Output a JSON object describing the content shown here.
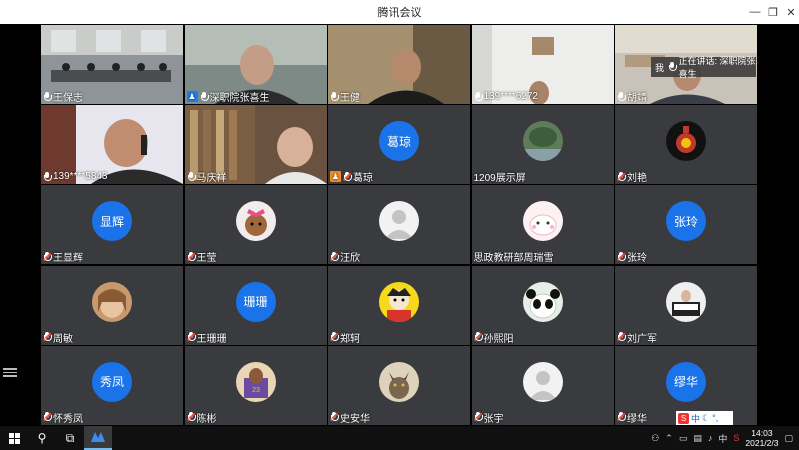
{
  "window": {
    "title": "腾讯会议"
  },
  "speaking_tip": {
    "me": "我",
    "label": "正在讲话: 深职院张喜生"
  },
  "participants": [
    {
      "name": "王保志"
    },
    {
      "name": "深职院张喜生"
    },
    {
      "name": "王健"
    },
    {
      "name": "139****6272"
    },
    {
      "name": "胡靖"
    },
    {
      "name": "139****5843"
    },
    {
      "name": "马庆祥"
    },
    {
      "name": "葛琼",
      "avatar_text": "葛琼"
    },
    {
      "name": "1209展示屏"
    },
    {
      "name": "刘艳"
    },
    {
      "name": "王显辉",
      "avatar_text": "显辉"
    },
    {
      "name": "王莹"
    },
    {
      "name": "汪欣"
    },
    {
      "name": "思政教研部周瑞雪"
    },
    {
      "name": "张玲",
      "avatar_text": "张玲"
    },
    {
      "name": "周敏"
    },
    {
      "name": "王珊珊",
      "avatar_text": "珊珊"
    },
    {
      "name": "郑轲"
    },
    {
      "name": "孙熙阳"
    },
    {
      "name": "刘广军"
    },
    {
      "name": "怀秀凤",
      "avatar_text": "秀凤"
    },
    {
      "name": "陈彬"
    },
    {
      "name": "史安华"
    },
    {
      "name": "张宇"
    },
    {
      "name": "缪华",
      "avatar_text": "缪华"
    }
  ],
  "ime": {
    "s": "S",
    "lang": "中"
  },
  "taskbar": {
    "time": "14:03",
    "date": "2021/2/3"
  },
  "colors": {
    "avatar_blue": "#1a73e8",
    "tile_bg": "#3a3b3e",
    "speaking_green": "#2ecc71"
  }
}
